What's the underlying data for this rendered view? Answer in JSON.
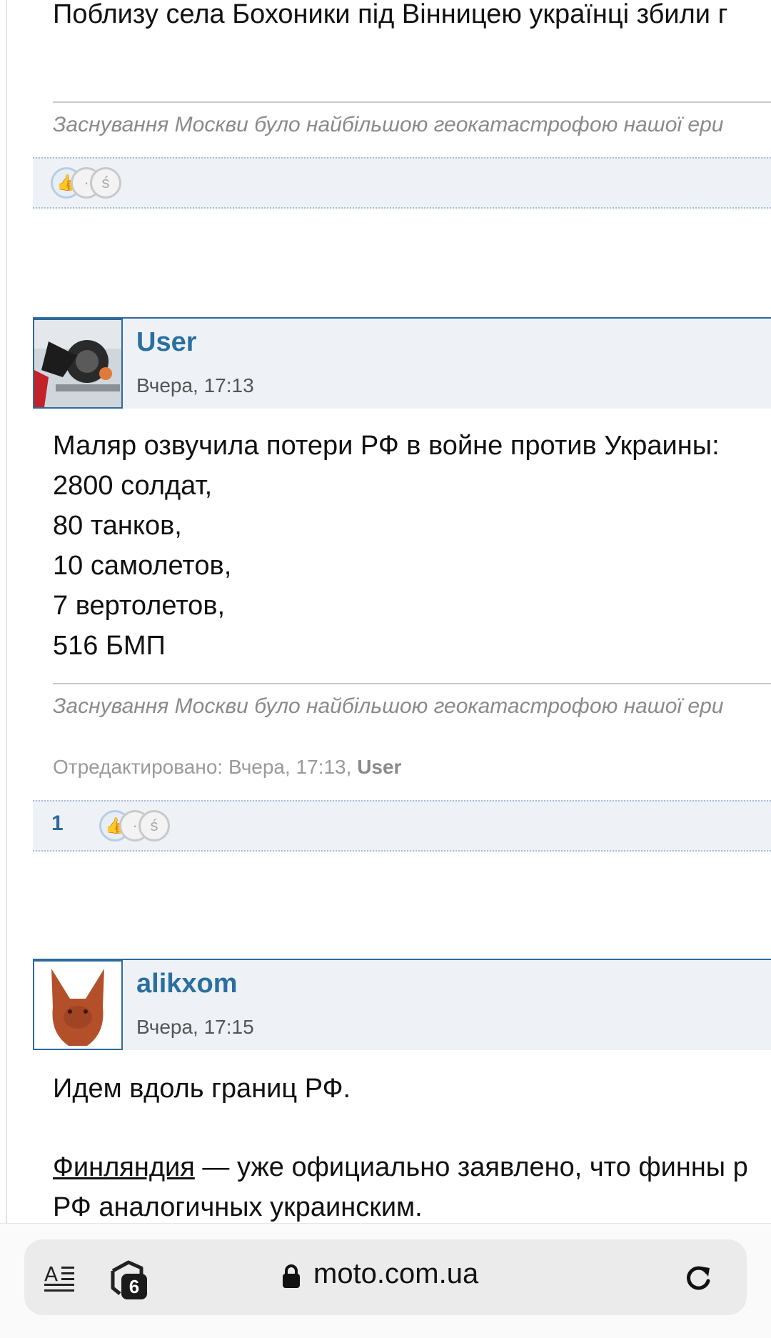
{
  "post1": {
    "text_line": "Поблизу села Бохоники під Вінницею українці збили г",
    "signature": "Заснування Москви було найбільшою геокатастрофою нашої ери"
  },
  "post2": {
    "username": "User",
    "time": "Вчера, 17:13",
    "lines": [
      "Маляр озвучила потери РФ в войне против Украины:",
      "2800 солдат,",
      "80 танков,",
      "10 самолетов,",
      "7 вертолетов,",
      "516 БМП"
    ],
    "signature": "Заснування Москви було найбільшою геокатастрофою нашої ери",
    "edited_prefix": "Отредактировано: Вчера, 17:13, ",
    "edited_user": "User",
    "reaction_count": "1"
  },
  "post3": {
    "username": "alikxom",
    "time": "Вчера, 17:15",
    "line1": "Идем вдоль границ РФ.",
    "link_text": "Финляндия",
    "line2_rest": " — уже официально заявлено, что финны р",
    "line3": "РФ аналогичных украинским."
  },
  "browser": {
    "url": "moto.com.ua",
    "tab_count": "6"
  },
  "icons": {
    "reader": "reader-mode-icon",
    "tabs": "tabs-icon",
    "lock": "lock-icon",
    "reload": "reload-icon",
    "like": "thumbs-up-icon",
    "neutral": "neutral-face-icon",
    "laugh": "laugh-face-icon"
  },
  "colors": {
    "accent": "#2f6a9a",
    "username": "#2a6fa0",
    "header_bg": "#eef2f7"
  }
}
